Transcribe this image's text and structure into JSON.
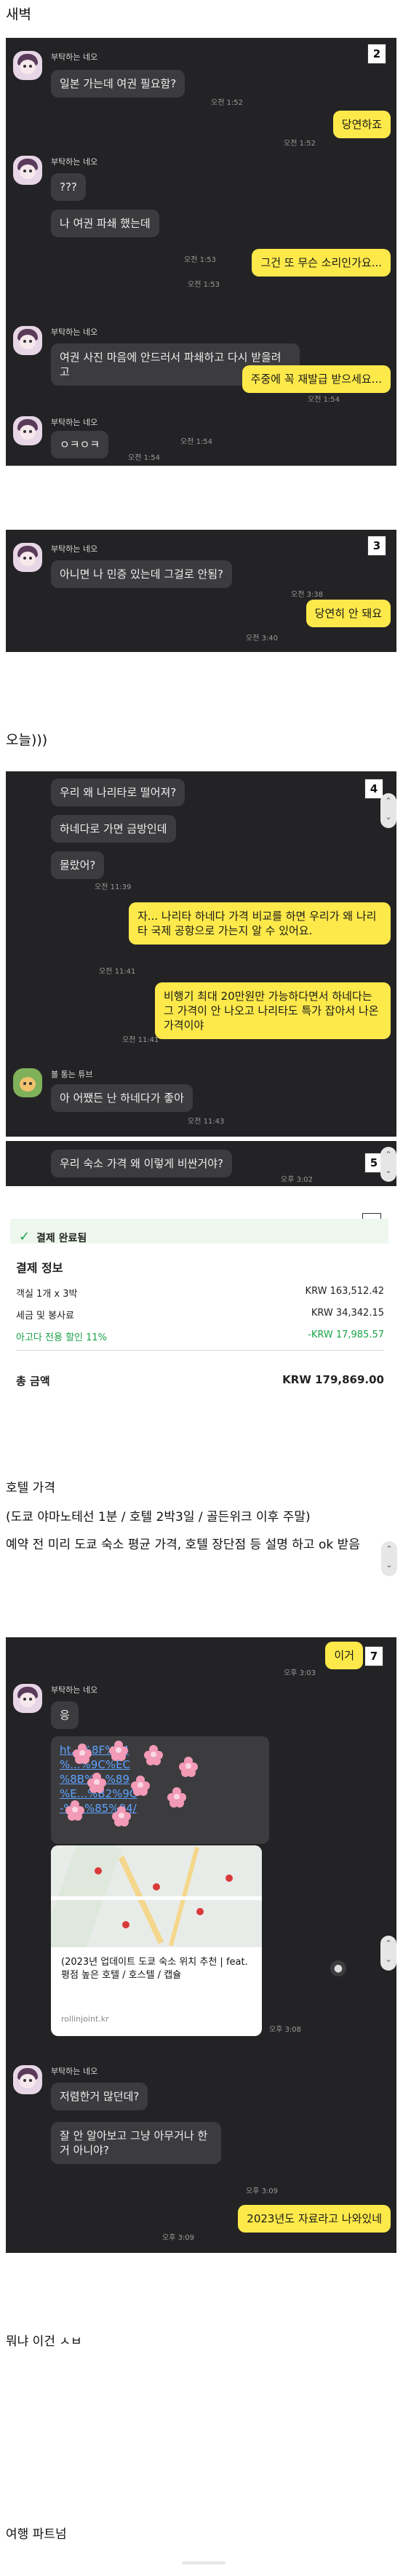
{
  "sections": {
    "s1": "새벽",
    "s2": "오늘)))",
    "s3a": "호텔 가격",
    "s3b": "(도쿄 야마노테선 1분 / 호텔 2박3일 / 골든위크 이후 주말)",
    "s3c": "예약 전 미리 도쿄 숙소 평균 가격, 호텔 장단점 등 설명 하고 ok 받음",
    "s4": "뭐냐 이건 ㅅㅂ",
    "s5": "여행 파트넘"
  },
  "chat1": {
    "badge": "2",
    "friend_name": "부탁하는 네오",
    "m1": "일본 가는데 여권 필요함?",
    "t1": "오전 1:52",
    "r1": "당연하죠",
    "rt1": "오전 1:52",
    "m2": "???",
    "m3": "나 여권 파쇄 했는데",
    "t3": "오전 1:53",
    "r2": "그건 또 무슨 소리인가요...",
    "rt2": "오전 1:53",
    "m4": "여권 사진 마음에 안드러서 파쇄하고 다시 받을려고",
    "t4": "오전 1:54",
    "r3": "주중에 꼭 재발급 받으세요...",
    "rt3": "오전 1:54",
    "m5": "ㅇㅋㅇㅋ",
    "t5": "오전 1:54"
  },
  "chat2": {
    "badge": "3",
    "friend_name": "부탁하는 네오",
    "m1": "아니면 나 민증 있는데 그걸로 안됨?",
    "t1": "오전 3:38",
    "r1": "당연히 안 돼요",
    "rt1": "오전 3:40"
  },
  "chat3": {
    "badge": "4",
    "m1": "우리 왜 나리타로 떨어져?",
    "m2": "하네다로 가면 금방인데",
    "m3": "몰랐어?",
    "t3": "오전 11:39",
    "r1": "자... 나리타 하네다 가격 비교를 하면 우리가 왜 나리타 국제 공항으로 가는지 알 수 있어요.",
    "rt1": "오전 11:41",
    "r2": "비행기 최대 20만원만 가능하다면서 하네다는 그 가격이 안 나오고 나리타도 특가 잡아서 나온 가격이야",
    "rt2": "오전 11:41",
    "friend2_name": "볼 통는 튜브",
    "m4": "아 어쨌든 난 하네다가 좋아",
    "t4": "오전 11:43"
  },
  "chat4": {
    "badge": "5",
    "m1": "우리 숙소 가격 왜 이렇게 비싼거야?",
    "t1": "오후 3:02"
  },
  "receipt": {
    "badge": "6",
    "status": "결제 완료됨",
    "title": "결제 정보",
    "rows": [
      {
        "label": "객실 1개 x 3박",
        "value": "KRW 163,512.42"
      },
      {
        "label": "세금 및 봉사료",
        "value": "KRW 34,342.15"
      },
      {
        "label": "아고다 전용 할인 11%",
        "value": "-KRW 17,985.57"
      }
    ],
    "total_label": "총 금액",
    "total_value": "KRW 179,869.00"
  },
  "chat5": {
    "badge": "7",
    "r0": "이거",
    "rt0": "오후 3:03",
    "friend_name": "부탁하는 네오",
    "m1": "응",
    "link": "https://rollinjoint.kr/%EB%8F%84%EC%BF%84-%EC%88%99%EC%86%8C-%EC%9C%84%EC%B9%98-%EC%B6%94%EC%B2%9C%EB%8B%A4%EA%B0%80%ED%8E%98/",
    "link_lines": [
      "ht...%8F%84",
      "%...%9C%EC",
      "%8B%...%89",
      "%E...%B2%9C",
      "-%...%85%94/"
    ],
    "preview_title": "(2023년 업데이트 도쿄 숙소 위치 추천 | feat. 평점 높은 호텔 / 호스텔 / 캡슐",
    "preview_domain": "rollinjoint.kr",
    "t1": "오후 3:08",
    "m2": "저렴한거 많던데?",
    "m3": "잘 안 알아보고 그냥 아무거나 한거 아니야?",
    "t3": "오후 3:09",
    "r1": "2023년도 자료라고 나와있네",
    "rt1": "오후 3:09"
  }
}
